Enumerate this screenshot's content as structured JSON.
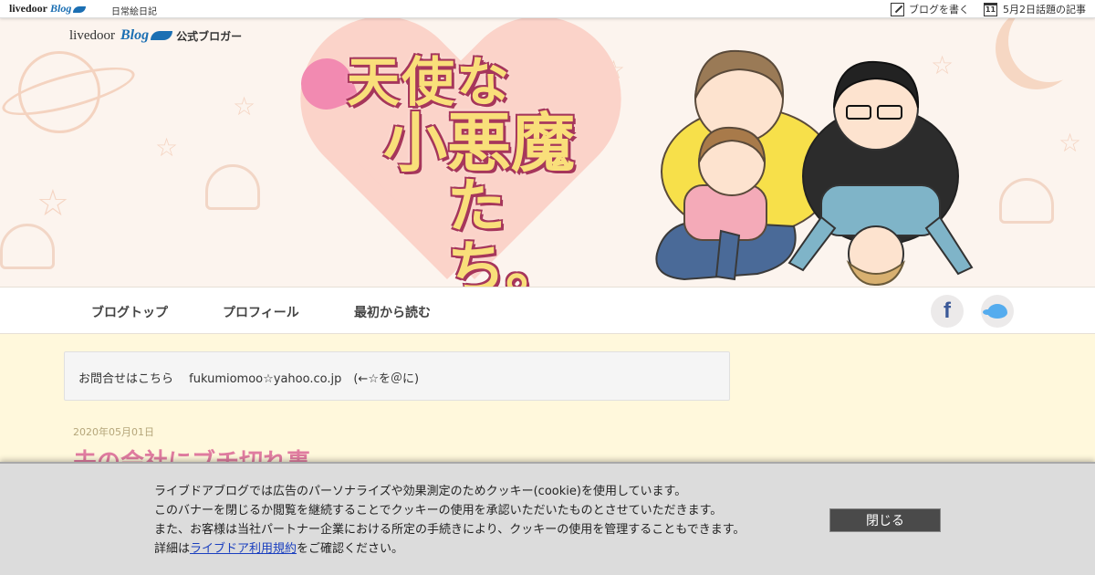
{
  "topbar": {
    "logo_text": "livedoor",
    "logo_blog": "Blog",
    "category": "日常絵日記",
    "write_blog": "ブログを書く",
    "calendar_day": "11",
    "topics": "5月2日話題の記事"
  },
  "header": {
    "official_logo_text": "livedoor",
    "official_logo_blog": "Blog",
    "official_label": "公式ブロガー",
    "title_line1": "天使な",
    "title_line2": "小悪魔",
    "title_line3": "たち。"
  },
  "nav": {
    "items": [
      {
        "label": "ブログトップ"
      },
      {
        "label": "プロフィール"
      },
      {
        "label": "最初から読む"
      }
    ],
    "facebook_glyph": "f"
  },
  "contact": {
    "text": "お問合せはこちら　 fukumiomoo☆yahoo.co.jp　(←☆を＠に)"
  },
  "post": {
    "date": "2020年05月01日",
    "title": "夫の会社にブチ切れ事"
  },
  "cookie_banner": {
    "line1": "ライブドアブログでは広告のパーソナライズや効果測定のためクッキー(cookie)を使用しています。",
    "line2": "このバナーを閉じるか閲覧を継続することでクッキーの使用を承認いただいたものとさせていただきます。",
    "line3": "また、お客様は当社パートナー企業における所定の手続きにより、クッキーの使用を管理することもできます。",
    "line4_prefix": "詳細は",
    "line4_link": "ライブドア利用規約",
    "line4_suffix": "をご確認ください。",
    "close_label": "閉じる"
  },
  "colors": {
    "nav_bg": "#ffffff",
    "body_bg": "#fff8dc",
    "post_title": "#e07ca0",
    "close_button": "#4a4a4a",
    "twitter": "#55acee",
    "facebook": "#3b5998"
  },
  "icons": {
    "write": "pen-icon",
    "calendar": "calendar-icon",
    "facebook": "facebook-icon",
    "twitter": "twitter-icon"
  }
}
